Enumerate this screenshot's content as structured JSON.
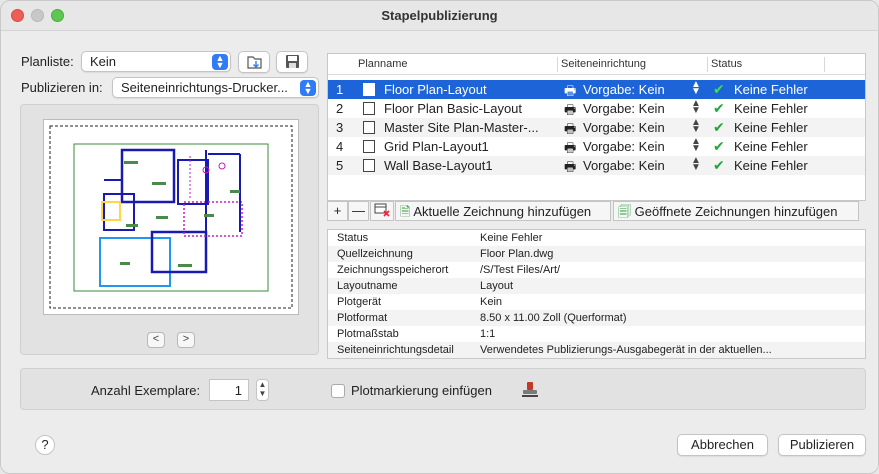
{
  "window": {
    "title": "Stapelpublizierung"
  },
  "top": {
    "planliste_label": "Planliste:",
    "planliste_value": "Kein",
    "publizieren_label": "Publizieren in:",
    "publizieren_value": "Seiteneinrichtungs-Drucker..."
  },
  "table": {
    "columns": [
      "Planname",
      "Seiteneinrichtung",
      "Status"
    ],
    "rows": [
      {
        "num": "1",
        "name": "Floor Plan-Layout",
        "setup": "Vorgabe: Kein",
        "status": "Keine Fehler",
        "selected": true
      },
      {
        "num": "2",
        "name": "Floor Plan Basic-Layout",
        "setup": "Vorgabe: Kein",
        "status": "Keine Fehler"
      },
      {
        "num": "3",
        "name": "Master Site Plan-Master-...",
        "setup": "Vorgabe: Kein",
        "status": "Keine Fehler"
      },
      {
        "num": "4",
        "name": "Grid Plan-Layout1",
        "setup": "Vorgabe: Kein",
        "status": "Keine Fehler"
      },
      {
        "num": "5",
        "name": "Wall Base-Layout1",
        "setup": "Vorgabe: Kein",
        "status": "Keine Fehler"
      }
    ]
  },
  "toolbar": {
    "add_label": "+",
    "remove_label": "—",
    "add_current": "Aktuelle Zeichnung hinzufügen",
    "add_open": "Geöffnete Zeichnungen hinzufügen"
  },
  "details": [
    {
      "k": "Status",
      "v": "Keine Fehler"
    },
    {
      "k": "Quellzeichnung",
      "v": "Floor Plan.dwg"
    },
    {
      "k": "Zeichnungsspeicherort",
      "v": "/S/Test Files/Art/"
    },
    {
      "k": "Layoutname",
      "v": "Layout"
    },
    {
      "k": "Plotgerät",
      "v": "Kein"
    },
    {
      "k": "Plotformat",
      "v": "8.50 x 11.00 Zoll (Querformat)"
    },
    {
      "k": "Plotmaßstab",
      "v": "1:1"
    },
    {
      "k": "Seiteneinrichtungsdetail",
      "v": "Verwendetes Publizierungs-Ausgabegerät in der aktuellen..."
    }
  ],
  "bottom": {
    "copies_label": "Anzahl Exemplare:",
    "copies_value": "1",
    "stamp_label": "Plotmarkierung einfügen",
    "help_label": "?",
    "cancel_label": "Abbrechen",
    "publish_label": "Publizieren"
  },
  "preview_nav": {
    "prev": "<",
    "next": ">"
  },
  "colors": {
    "accent": "#1c64d8",
    "ok": "#1fa83a"
  }
}
